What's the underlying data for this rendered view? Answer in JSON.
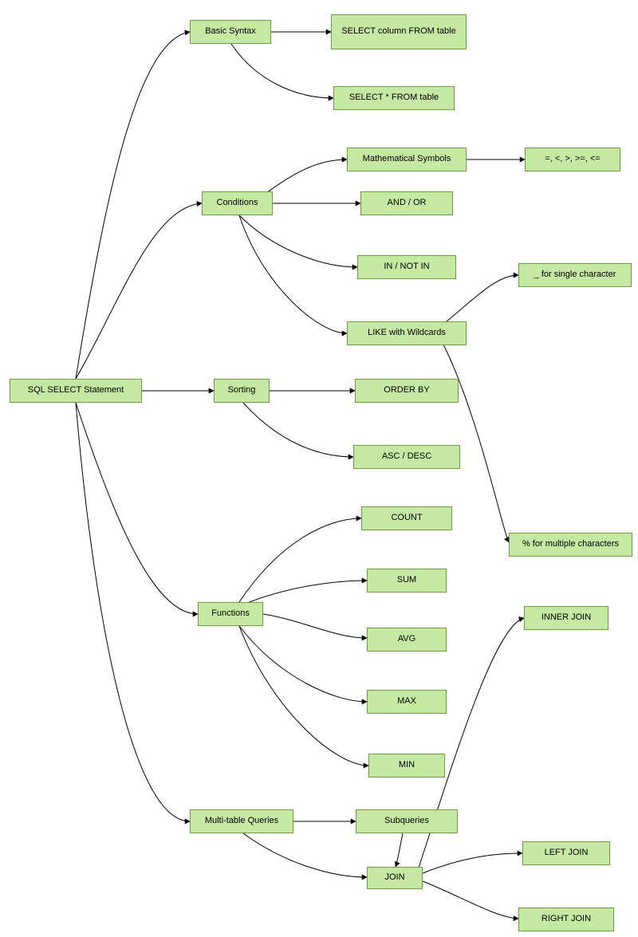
{
  "chart_data": {
    "type": "tree-diagram",
    "title": "SQL SELECT Statement",
    "root": "SQL SELECT Statement",
    "children": [
      {
        "name": "Basic Syntax",
        "children": [
          "SELECT column FROM table",
          "SELECT * FROM table"
        ]
      },
      {
        "name": "Conditions",
        "children": [
          {
            "name": "Mathematical Symbols",
            "children": [
              "=, <, >, >=, <="
            ]
          },
          "AND / OR",
          "IN / NOT IN",
          {
            "name": "LIKE with Wildcards",
            "children": [
              "_ for single character",
              "% for multiple characters"
            ]
          }
        ]
      },
      {
        "name": "Sorting",
        "children": [
          "ORDER BY",
          "ASC / DESC"
        ]
      },
      {
        "name": "Functions",
        "children": [
          "COUNT",
          "SUM",
          "AVG",
          "MAX",
          "MIN"
        ]
      },
      {
        "name": "Multi-table Queries",
        "children": [
          "Subqueries",
          {
            "name": "JOIN",
            "children": [
              "INNER JOIN",
              "LEFT JOIN",
              "RIGHT JOIN"
            ]
          }
        ]
      }
    ]
  },
  "nodes": {
    "root": "SQL SELECT Statement",
    "basic": "Basic Syntax",
    "basic1": "SELECT column FROM table",
    "basic2": "SELECT * FROM table",
    "cond": "Conditions",
    "cond_math": "Mathematical Symbols",
    "cond_sym": "=, <, >, >=, <=",
    "cond_andor": "AND / OR",
    "cond_in": "IN / NOT IN",
    "cond_like": "LIKE with Wildcards",
    "cond_us": "_ for single character",
    "cond_pct": "% for multiple characters",
    "sort": "Sorting",
    "sort_ob": "ORDER BY",
    "sort_ad": "ASC / DESC",
    "func": "Functions",
    "f_count": "COUNT",
    "f_sum": "SUM",
    "f_avg": "AVG",
    "f_max": "MAX",
    "f_min": "MIN",
    "multi": "Multi-table Queries",
    "m_sub": "Subqueries",
    "m_join": "JOIN",
    "j_inner": "INNER JOIN",
    "j_left": "LEFT JOIN",
    "j_right": "RIGHT JOIN"
  }
}
